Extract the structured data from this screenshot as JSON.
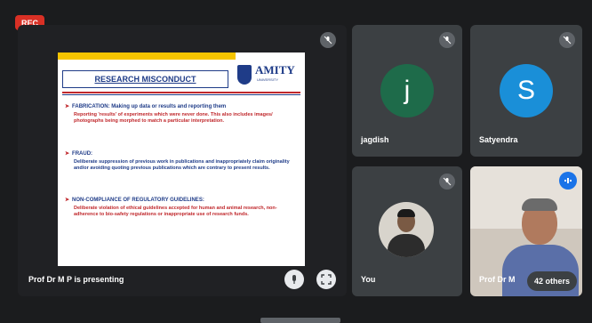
{
  "rec_label": "REC",
  "main": {
    "presenting_label": "Prof Dr M P is presenting",
    "slide": {
      "title": "RESEARCH MISCONDUCT",
      "logo_text": "AMITY",
      "logo_sub": "UNIVERSITY",
      "bullets": [
        {
          "head": "FABRICATION: Making up data or results and reporting them",
          "body": "Reporting 'results' of experiments which were never done. This also includes images/ photographs being morphed to match a particular interpretation."
        },
        {
          "head": "FRAUD:",
          "body": "Deliberate suppression of previous work in publications and inappropriately claim originality and/or avoiding quoting previous publications which are contrary to present results."
        },
        {
          "head": "NON-COMPLIANCE OF REGULATORY GUIDELINES:",
          "body": "Deliberate violation of ethical guidelines accepted for human and animal research, non-adherence to bio-safety regulations or inappropriate use of research funds."
        }
      ]
    }
  },
  "participants": {
    "jagdish": {
      "name": "jagdish",
      "initial": "j",
      "color": "#1e6b4a"
    },
    "satyendra": {
      "name": "Satyendra",
      "initial": "S",
      "color": "#1a8fd8"
    },
    "you": {
      "name": "You"
    },
    "others": {
      "name": "Prof Dr M",
      "badge": "42 others"
    }
  },
  "icons": [
    "mic-off-icon",
    "more-options-icon",
    "fullscreen-icon",
    "speaking-icon"
  ]
}
